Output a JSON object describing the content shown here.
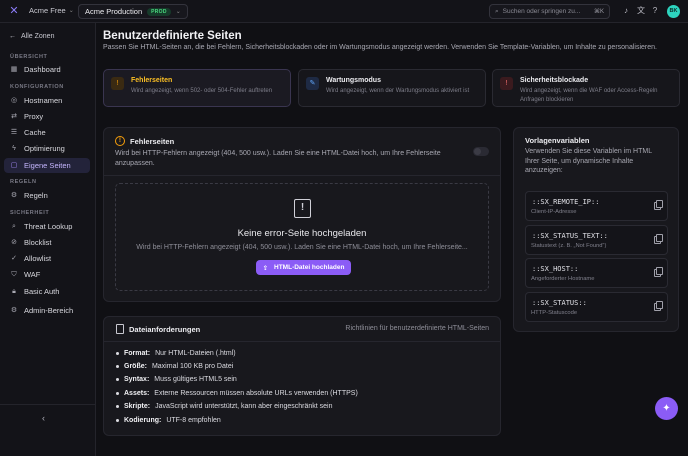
{
  "topbar": {
    "account": "Acme Free",
    "zone": "Acme Production",
    "zone_badge": "PROD",
    "search_placeholder": "Suchen oder springen zu...",
    "search_shortcut": "⌘K",
    "avatar_initials": "BK"
  },
  "sidebar": {
    "back_label": "Alle Zonen",
    "sections": {
      "overview": "ÜBERSICHT",
      "config": "KONFIGURATION",
      "rules": "REGELN",
      "security": "SICHERHEIT"
    },
    "items": {
      "dashboard": "Dashboard",
      "hostnames": "Hostnamen",
      "proxy": "Proxy",
      "cache": "Cache",
      "optimization": "Optimierung",
      "custom_pages": "Eigene Seiten",
      "rules": "Regeln",
      "threat_lookup": "Threat Lookup",
      "blocklist": "Blocklist",
      "allowlist": "Allowlist",
      "waf": "WAF",
      "basic_auth": "Basic Auth",
      "admin_area": "Admin-Bereich"
    }
  },
  "page": {
    "title": "Benutzerdefinierte Seiten",
    "subtitle": "Passen Sie HTML-Seiten an, die bei Fehlern, Sicherheitsblockaden oder im Wartungsmodus angezeigt werden. Verwenden Sie Template-Variablen, um Inhalte zu personalisieren."
  },
  "type_cards": [
    {
      "title": "Fehlerseiten",
      "desc": "Wird angezeigt, wenn 502- oder 504-Fehler auftreten"
    },
    {
      "title": "Wartungsmodus",
      "desc": "Wird angezeigt, wenn der Wartungsmodus aktiviert ist"
    },
    {
      "title": "Sicherheitsblockade",
      "desc": "Wird angezeigt, wenn die WAF oder Access-Regeln Anfragen blockieren"
    }
  ],
  "error_panel": {
    "title": "Fehlerseiten",
    "desc": "Wird bei HTTP-Fehlern angezeigt (404, 500 usw.). Laden Sie eine HTML-Datei hoch, um Ihre Fehlerseite anzupassen.",
    "empty_title": "Keine error-Seite hochgeladen",
    "empty_desc": "Wird bei HTTP-Fehlern angezeigt (404, 500 usw.). Laden Sie eine HTML-Datei hoch, um Ihre Fehlerseite...",
    "upload_button": "HTML-Datei hochladen"
  },
  "requirements": {
    "title": "Dateianforderungen",
    "right": "Richtlinien für benutzerdefinierte HTML-Seiten",
    "items": [
      {
        "key": "Format:",
        "val": "Nur HTML-Dateien (.html)"
      },
      {
        "key": "Größe:",
        "val": "Maximal 100 KB pro Datei"
      },
      {
        "key": "Syntax:",
        "val": "Muss gültiges HTML5 sein"
      },
      {
        "key": "Assets:",
        "val": "Externe Ressourcen müssen absolute URLs verwenden (HTTPS)"
      },
      {
        "key": "Skripte:",
        "val": "JavaScript wird unterstützt, kann aber eingeschränkt sein"
      },
      {
        "key": "Kodierung:",
        "val": "UTF-8 empfohlen"
      }
    ]
  },
  "variables": {
    "title": "Vorlagenvariablen",
    "desc": "Verwenden Sie diese Variablen im HTML Ihrer Seite, um dynamische Inhalte anzuzeigen:",
    "items": [
      {
        "name": "::SX_REMOTE_IP::",
        "desc": "Client-IP-Adresse"
      },
      {
        "name": "::SX_STATUS_TEXT::",
        "desc": "Statustext (z. B. „Not Found“)"
      },
      {
        "name": "::SX_HOST::",
        "desc": "Angeforderter Hostname"
      },
      {
        "name": "::SX_STATUS::",
        "desc": "HTTP-Statuscode"
      }
    ]
  },
  "colors": {
    "accent": "#8b5cf6",
    "active_nav": "#c4b5fd",
    "prod_badge": "#4ade80",
    "warning": "#f59e0b"
  }
}
